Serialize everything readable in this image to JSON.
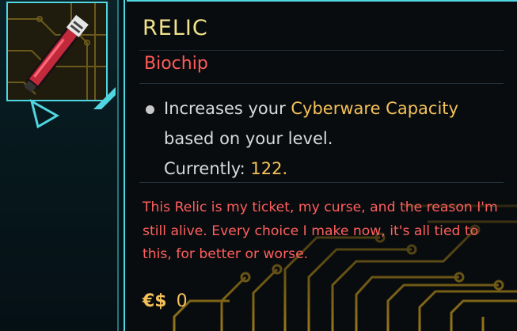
{
  "item": {
    "name": "RELIC",
    "type": "Biochip",
    "description": {
      "prefix": "Increases your ",
      "highlight": "Cyberware Capacity",
      "suffix": " based on your level.",
      "currently_label": "Currently: ",
      "currently_value": "122."
    },
    "flavor_text": "This Relic is my ticket, my curse, and the reason I'm still alive. Every choice I make now, it's all tied to this, for better or worse.",
    "price": {
      "currency_symbol": "€$",
      "value": "0"
    }
  },
  "icons": {
    "thumbnail": "relic-biochip-icon",
    "cursor": "triangle-cursor-icon",
    "currency": "eurodollar-icon"
  },
  "colors": {
    "title": "#f0e28a",
    "type": "#ff5a5a",
    "highlight": "#f5c15a",
    "flavor": "#ff5e5e",
    "accent": "#4fd6e0"
  }
}
